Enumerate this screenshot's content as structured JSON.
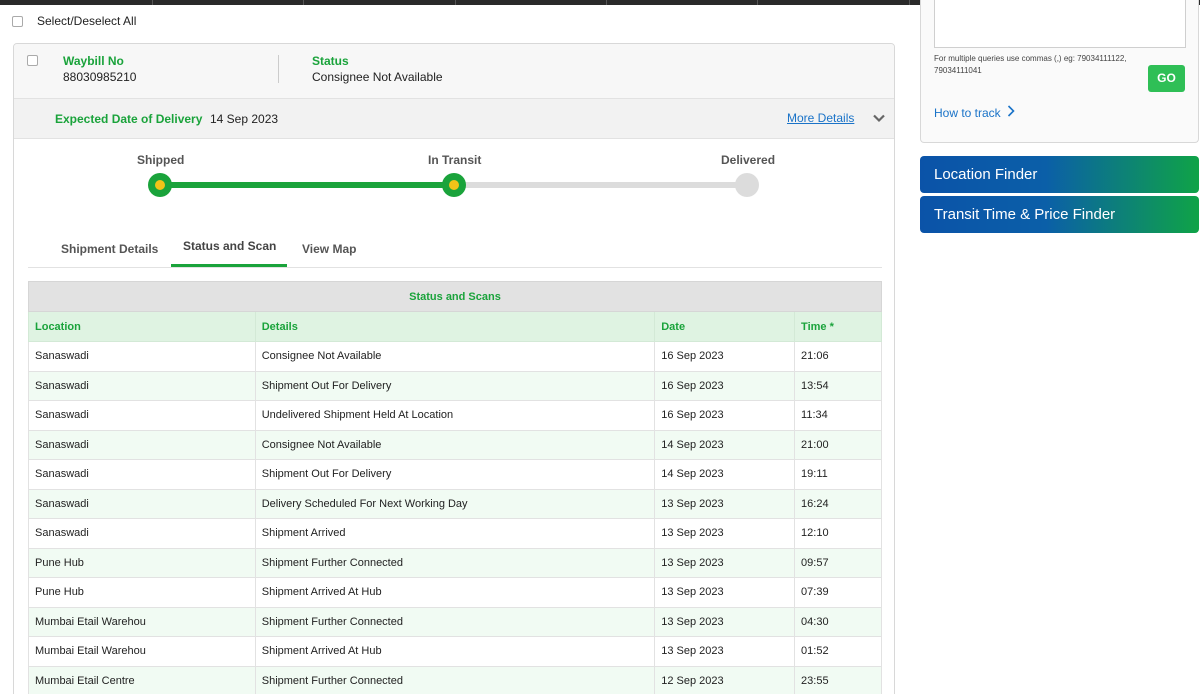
{
  "select_all": {
    "label": "Select/Deselect All"
  },
  "shipment": {
    "waybill_label": "Waybill No",
    "waybill_value": "88030985210",
    "status_label": "Status",
    "status_value": "Consignee Not Available",
    "edd_label": "Expected Date of Delivery",
    "edd_value": "14 Sep 2023",
    "more_details": "More Details"
  },
  "progress": {
    "steps": [
      {
        "label": "Shipped",
        "state": "done"
      },
      {
        "label": "In Transit",
        "state": "done"
      },
      {
        "label": "Delivered",
        "state": "pending"
      }
    ],
    "active_color": "#1aa33b",
    "marker_color": "#f2c318",
    "inactive_color": "#dcdcdc"
  },
  "tabs": [
    {
      "label": "Shipment Details"
    },
    {
      "label": "Status and Scan",
      "active": true
    },
    {
      "label": "View Map"
    }
  ],
  "scans": {
    "caption": "Status and Scans",
    "headers": [
      "Location",
      "Details",
      "Date",
      "Time *"
    ],
    "rows": [
      [
        "Sanaswadi",
        "Consignee Not Available",
        "16 Sep 2023",
        "21:06"
      ],
      [
        "Sanaswadi",
        "Shipment Out For Delivery",
        "16 Sep 2023",
        "13:54"
      ],
      [
        "Sanaswadi",
        "Undelivered Shipment Held At Location",
        "16 Sep 2023",
        "11:34"
      ],
      [
        "Sanaswadi",
        "Consignee Not Available",
        "14 Sep 2023",
        "21:00"
      ],
      [
        "Sanaswadi",
        "Shipment Out For Delivery",
        "14 Sep 2023",
        "19:11"
      ],
      [
        "Sanaswadi",
        "Delivery Scheduled For Next Working Day",
        "13 Sep 2023",
        "16:24"
      ],
      [
        "Sanaswadi",
        "Shipment Arrived",
        "13 Sep 2023",
        "12:10"
      ],
      [
        "Pune Hub",
        "Shipment Further Connected",
        "13 Sep 2023",
        "09:57"
      ],
      [
        "Pune Hub",
        "Shipment Arrived At Hub",
        "13 Sep 2023",
        "07:39"
      ],
      [
        "Mumbai Etail Warehou",
        "Shipment Further Connected",
        "13 Sep 2023",
        "04:30"
      ],
      [
        "Mumbai Etail Warehou",
        "Shipment Arrived At Hub",
        "13 Sep 2023",
        "01:52"
      ],
      [
        "Mumbai Etail Centre",
        "Shipment Further Connected",
        "12 Sep 2023",
        "23:55"
      ]
    ]
  },
  "track_panel": {
    "input_value": "",
    "hint": "For multiple queries use commas (,) eg: 79034111122, 79034111041",
    "go_label": "GO",
    "how_to_track": "How to track"
  },
  "finders": [
    {
      "label": "Location Finder"
    },
    {
      "label": "Transit Time & Price Finder"
    }
  ],
  "colors": {
    "brand_green": "#1aa33b",
    "link_blue": "#1a73c8",
    "brand_blue": "#0b53a8"
  }
}
